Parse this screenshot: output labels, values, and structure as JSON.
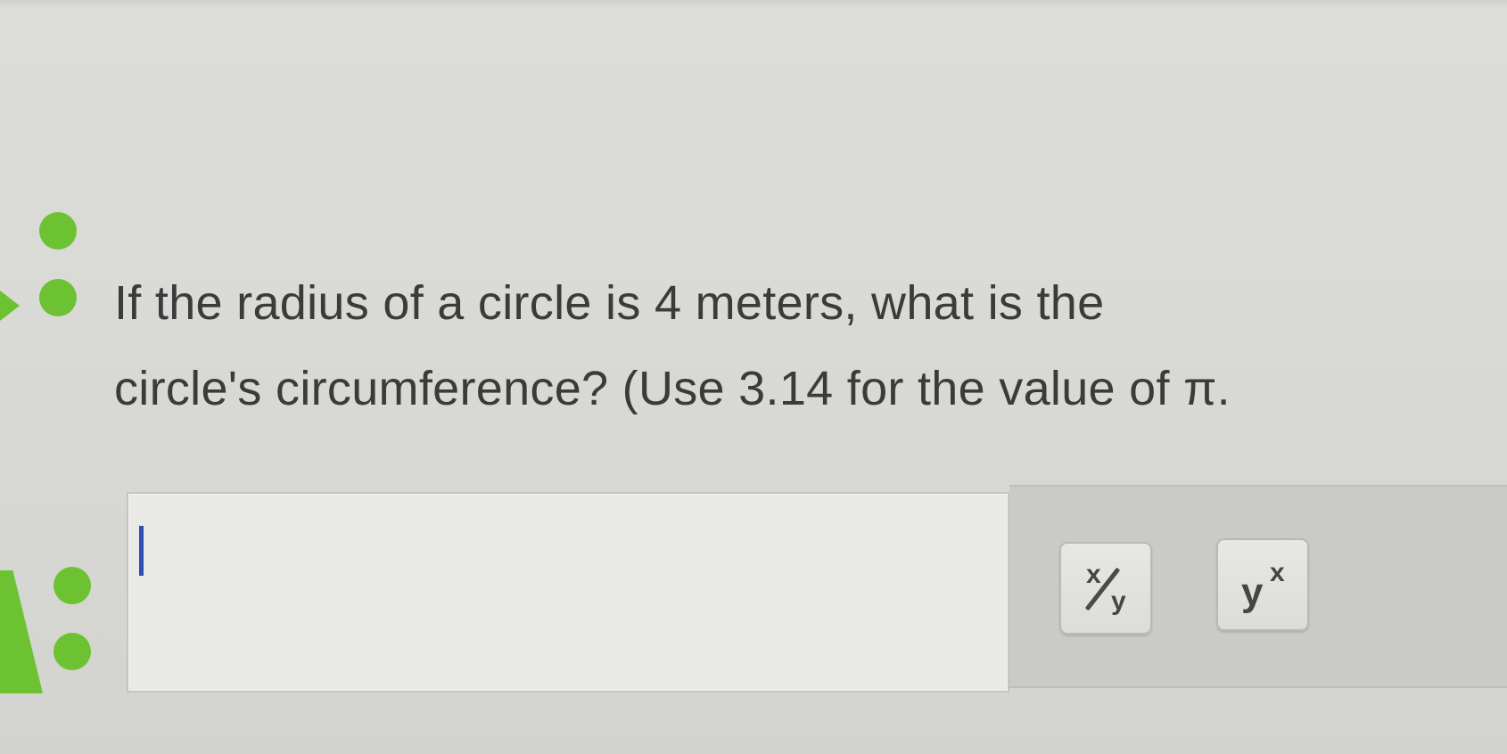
{
  "question": {
    "line1": "If the radius of a circle is 4 meters, what is the",
    "line2": "circle's circumference? (Use 3.14 for the value of π."
  },
  "answer": {
    "value": ""
  },
  "toolbar": {
    "fraction_numerator": "x",
    "fraction_denominator": "y",
    "power_base": "y",
    "power_exponent": "x"
  },
  "colors": {
    "accent": "#6cc231",
    "text": "#3b3b3b",
    "cursor": "#2d4fb5"
  }
}
